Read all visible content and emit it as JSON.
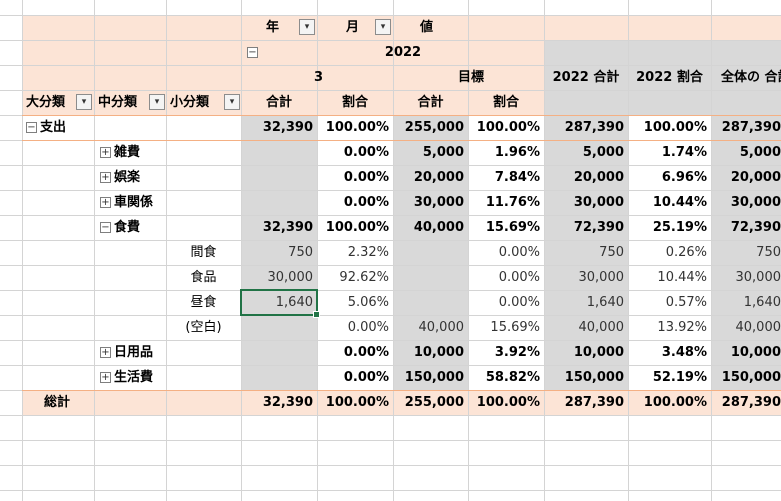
{
  "header": {
    "year_label": "年",
    "month_label": "月",
    "value_label": "値",
    "year_value": "2022",
    "month_value": "3",
    "target_label": "目標",
    "year_total_label": "2022 合計",
    "year_ratio_label": "2022 割合",
    "grand_label": "全体の 合計",
    "major_label": "大分類",
    "middle_label": "中分類",
    "minor_label": "小分類",
    "sum_label": "合計",
    "ratio_label": "割合"
  },
  "rows": [
    {
      "label": "支出",
      "kind": "major",
      "expander": "minus",
      "bold": true,
      "v": [
        "32,390",
        "100.00%",
        "255,000",
        "100.00%",
        "287,390",
        "100.00%",
        "287,390"
      ]
    },
    {
      "label": "雑費",
      "kind": "middle",
      "expander": "plus",
      "bold": true,
      "v": [
        "",
        "0.00%",
        "5,000",
        "1.96%",
        "5,000",
        "1.74%",
        "5,000"
      ]
    },
    {
      "label": "娯楽",
      "kind": "middle",
      "expander": "plus",
      "bold": true,
      "v": [
        "",
        "0.00%",
        "20,000",
        "7.84%",
        "20,000",
        "6.96%",
        "20,000"
      ]
    },
    {
      "label": "車関係",
      "kind": "middle",
      "expander": "plus",
      "bold": true,
      "v": [
        "",
        "0.00%",
        "30,000",
        "11.76%",
        "30,000",
        "10.44%",
        "30,000"
      ]
    },
    {
      "label": "食費",
      "kind": "middle",
      "expander": "minus",
      "bold": true,
      "v": [
        "32,390",
        "100.00%",
        "40,000",
        "15.69%",
        "72,390",
        "25.19%",
        "72,390"
      ]
    },
    {
      "label": "間食",
      "kind": "minor",
      "expander": "",
      "bold": false,
      "v": [
        "750",
        "2.32%",
        "",
        "0.00%",
        "750",
        "0.26%",
        "750"
      ]
    },
    {
      "label": "食品",
      "kind": "minor",
      "expander": "",
      "bold": false,
      "v": [
        "30,000",
        "92.62%",
        "",
        "0.00%",
        "30,000",
        "10.44%",
        "30,000"
      ]
    },
    {
      "label": "昼食",
      "kind": "minor",
      "expander": "",
      "bold": false,
      "v": [
        "1,640",
        "5.06%",
        "",
        "0.00%",
        "1,640",
        "0.57%",
        "1,640"
      ]
    },
    {
      "label": "(空白)",
      "kind": "minor",
      "expander": "",
      "bold": false,
      "v": [
        "",
        "0.00%",
        "40,000",
        "15.69%",
        "40,000",
        "13.92%",
        "40,000"
      ]
    },
    {
      "label": "日用品",
      "kind": "middle",
      "expander": "plus",
      "bold": true,
      "v": [
        "",
        "0.00%",
        "10,000",
        "3.92%",
        "10,000",
        "3.48%",
        "10,000"
      ]
    },
    {
      "label": "生活費",
      "kind": "middle",
      "expander": "plus",
      "bold": true,
      "v": [
        "",
        "0.00%",
        "150,000",
        "58.82%",
        "150,000",
        "52.19%",
        "150,000"
      ]
    }
  ],
  "total": {
    "label": "総計",
    "v": [
      "32,390",
      "100.00%",
      "255,000",
      "100.00%",
      "287,390",
      "100.00%",
      "287,390"
    ]
  },
  "colors": {
    "peach": "#fce4d6",
    "gray": "#d9d9d9",
    "grid": "#d4d4d4",
    "selection": "#217346",
    "separator": "#f4b084"
  },
  "icons": {
    "filter": "filter-dropdown-icon",
    "dropdown": "chevron-down-icon",
    "collapse": "collapse-icon",
    "expand": "expand-icon"
  }
}
